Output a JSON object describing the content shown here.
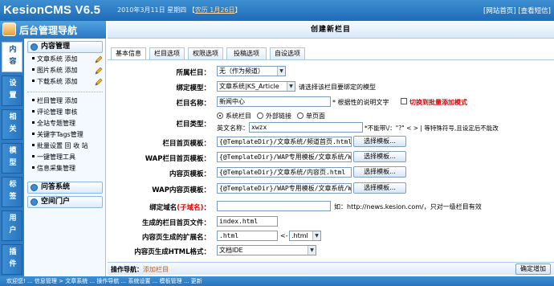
{
  "app": {
    "logo": "KesionCMS V6.5",
    "date": "2010年3月11日 星期四",
    "lunar": "农历 1月26日",
    "top_links": [
      "[网站首页]",
      "[查看短信",
      "]"
    ]
  },
  "nav": {
    "title": "后台管理导航",
    "vtabs": [
      "内容",
      "设置",
      "相关",
      "模型",
      "标签",
      "用户",
      "插件"
    ],
    "groups": {
      "content_mgmt": "内容管理",
      "qa": "问答系统",
      "space": "空间门户"
    },
    "content_items": [
      {
        "label": "文章系统",
        "action": "添加"
      },
      {
        "label": "图片系统",
        "action": "添加"
      },
      {
        "label": "下载系统",
        "action": "添加"
      }
    ],
    "manage_items": [
      {
        "label": "栏目管理",
        "action": "添加"
      },
      {
        "label": "评论管理",
        "action": "审核"
      },
      {
        "label": "全站专题管理",
        "action": ""
      },
      {
        "label": "关键字Tags管理",
        "action": ""
      },
      {
        "label": "批量设置",
        "action": "回 收 站"
      },
      {
        "label": "一键管理工具",
        "action": ""
      },
      {
        "label": "信息采集管理",
        "action": ""
      }
    ]
  },
  "main": {
    "title": "创建新栏目",
    "tabs": [
      "基本信息",
      "栏目选项",
      "权限选项",
      "投稿选项",
      "自设选项"
    ],
    "fields": {
      "parent": {
        "label": "所属栏目：",
        "value": "无（作为频道）"
      },
      "model": {
        "label": "绑定模型：",
        "value": "文章系统|KS_Article",
        "note": "请选择该栏目要绑定的模型"
      },
      "name": {
        "label": "栏目名称：",
        "value": "新闻中心",
        "note": "* 根据性的说明文字",
        "batch": "切换到批量添加模式"
      },
      "type": {
        "label": "栏目类型：",
        "options": [
          "系统栏目",
          "外部链接",
          "单页面"
        ],
        "en_label": "英文名称：",
        "en_value": "xwzx",
        "en_note": "*不能带\\/：\"?\" < > | 等特殊符号,且设定后不能改"
      },
      "index_tpl": {
        "label": "栏目首页模板：",
        "value": "{@TemplateDir}/文章系统/频道首页.html",
        "btn": "选择模板..."
      },
      "wap_index_tpl": {
        "label": "WAP栏目首页模板：",
        "value": "{@TemplateDir}/WAP专用模板/文章系统/W",
        "btn": "选择模板..."
      },
      "content_tpl": {
        "label": "内容页模板：",
        "value": "{@TemplateDir}/文章系统/内容页.html",
        "btn": "选择模板..."
      },
      "wap_content_tpl": {
        "label": "WAP内容页模板：",
        "value": "{@TemplateDir}/WAP专用模板/文章系统/W",
        "btn": "选择模板..."
      },
      "domain": {
        "label_main": "绑定域名",
        "label_sub": "(子域名)",
        "label_end": "：",
        "value": "",
        "note": "如：http://news.kesion.com/，只对一级栏目有效"
      },
      "index_file": {
        "label": "生成的栏目首页文件：",
        "value": "index.html"
      },
      "ext": {
        "label": "内容页生成的扩展名：",
        "value": ".html",
        "sep": "<-",
        "sel": ".html"
      },
      "html_format": {
        "label": "内容页生成HTML格式：",
        "value": "文档IDE"
      }
    },
    "op_bar": {
      "label": "操作导航：",
      "link": "添加栏目"
    },
    "confirm": "确定增加"
  },
  "footer": "欢迎您! ... 信息管理 > 文章系统 ... 操作导航 ... 系统设置 ... 模板管理 ... 更新"
}
